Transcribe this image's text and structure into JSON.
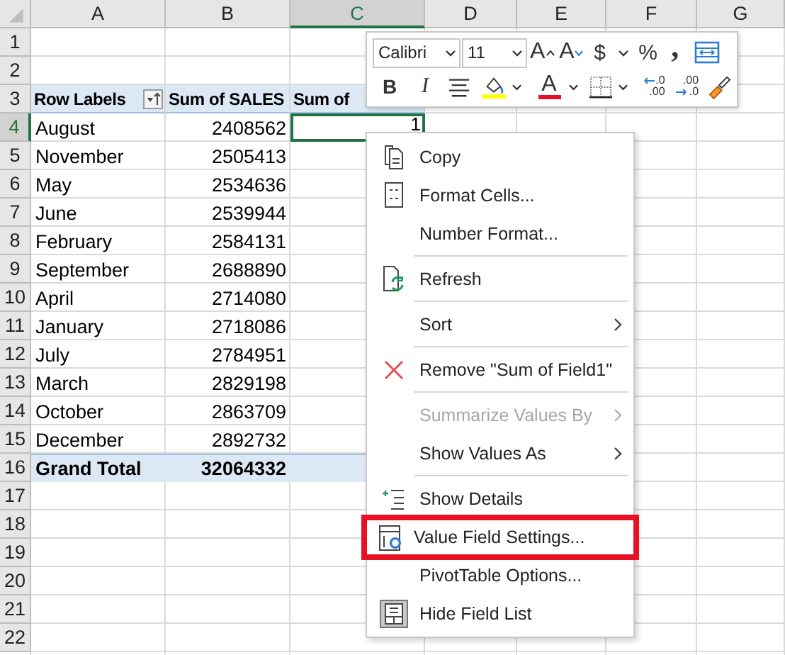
{
  "sheet": {
    "columns": [
      {
        "label": "A",
        "selected": false
      },
      {
        "label": "B",
        "selected": false
      },
      {
        "label": "C",
        "selected": true
      },
      {
        "label": "D",
        "selected": false
      },
      {
        "label": "E",
        "selected": false
      },
      {
        "label": "F",
        "selected": false
      },
      {
        "label": "G",
        "selected": false
      }
    ],
    "rows": [
      {
        "label": "1",
        "kind": "blank",
        "selected": false
      },
      {
        "label": "2",
        "kind": "blank",
        "selected": false
      },
      {
        "label": "3",
        "kind": "header",
        "selected": false,
        "filter_button": true,
        "cells": [
          "Row Labels",
          "Sum of SALES",
          "Sum of"
        ]
      },
      {
        "label": "4",
        "kind": "item",
        "selected": true,
        "cells": [
          "August",
          "2408562",
          "1"
        ]
      },
      {
        "label": "5",
        "kind": "item",
        "selected": false,
        "cells": [
          "November",
          "2505413"
        ]
      },
      {
        "label": "6",
        "kind": "item",
        "selected": false,
        "cells": [
          "May",
          "2534636"
        ]
      },
      {
        "label": "7",
        "kind": "item",
        "selected": false,
        "cells": [
          "June",
          "2539944"
        ]
      },
      {
        "label": "8",
        "kind": "item",
        "selected": false,
        "cells": [
          "February",
          "2584131"
        ]
      },
      {
        "label": "9",
        "kind": "item",
        "selected": false,
        "cells": [
          "September",
          "2688890"
        ]
      },
      {
        "label": "10",
        "kind": "item",
        "selected": false,
        "cells": [
          "April",
          "2714080"
        ]
      },
      {
        "label": "11",
        "kind": "item",
        "selected": false,
        "cells": [
          "January",
          "2718086"
        ]
      },
      {
        "label": "12",
        "kind": "item",
        "selected": false,
        "cells": [
          "July",
          "2784951"
        ]
      },
      {
        "label": "13",
        "kind": "item",
        "selected": false,
        "cells": [
          "March",
          "2829198"
        ]
      },
      {
        "label": "14",
        "kind": "item",
        "selected": false,
        "cells": [
          "October",
          "2863709"
        ]
      },
      {
        "label": "15",
        "kind": "item",
        "selected": false,
        "cells": [
          "December",
          "2892732"
        ]
      },
      {
        "label": "16",
        "kind": "total",
        "selected": false,
        "cells": [
          "Grand Total",
          "32064332"
        ]
      },
      {
        "label": "17",
        "kind": "blank",
        "selected": false
      },
      {
        "label": "18",
        "kind": "blank",
        "selected": false
      },
      {
        "label": "19",
        "kind": "blank",
        "selected": false
      },
      {
        "label": "20",
        "kind": "blank",
        "selected": false
      },
      {
        "label": "21",
        "kind": "blank",
        "selected": false
      },
      {
        "label": "22",
        "kind": "blank",
        "selected": false
      }
    ]
  },
  "mini_toolbar": {
    "font": "Calibri",
    "size": "11",
    "row1": [
      {
        "kind": "grow",
        "label": "A"
      },
      {
        "kind": "shrink",
        "label": "A"
      },
      {
        "kind": "text",
        "label": "$"
      },
      {
        "kind": "caret"
      },
      {
        "kind": "text",
        "label": "%"
      },
      {
        "kind": "comma",
        "label": ","
      },
      {
        "kind": "wrap"
      }
    ],
    "row2": [
      {
        "kind": "bold",
        "label": "B"
      },
      {
        "kind": "italic",
        "label": "I"
      },
      {
        "kind": "align"
      },
      {
        "kind": "fill"
      },
      {
        "kind": "caret"
      },
      {
        "kind": "fontcolor",
        "label": "A"
      },
      {
        "kind": "caret"
      },
      {
        "kind": "borders"
      },
      {
        "kind": "caret"
      },
      {
        "kind": "inc-decimal",
        "top": ".0",
        "bottom": ".00"
      },
      {
        "kind": "dec-decimal",
        "top": ".00",
        "bottom": ".0"
      },
      {
        "kind": "brush"
      }
    ]
  },
  "context_menu": {
    "groups": [
      [
        {
          "label": "Copy",
          "kind": "copy",
          "disabled": false,
          "submenu": false,
          "highlighted": false
        },
        {
          "label": "Format Cells...",
          "kind": "format",
          "disabled": false,
          "submenu": false,
          "highlighted": false
        },
        {
          "label": "Number Format...",
          "kind": "plain",
          "disabled": false,
          "submenu": false,
          "highlighted": false
        }
      ],
      [
        {
          "label": "Refresh",
          "kind": "refresh",
          "disabled": false,
          "submenu": false,
          "highlighted": false
        }
      ],
      [
        {
          "label": "Sort",
          "kind": "plain",
          "disabled": false,
          "submenu": true,
          "highlighted": false
        }
      ],
      [
        {
          "label": "Remove \"Sum of Field1\"",
          "kind": "remove",
          "disabled": false,
          "submenu": false,
          "highlighted": false
        }
      ],
      [
        {
          "label": "Summarize Values By",
          "kind": "plain",
          "disabled": true,
          "submenu": true,
          "highlighted": false
        },
        {
          "label": "Show Values As",
          "kind": "plain",
          "disabled": false,
          "submenu": true,
          "highlighted": false
        }
      ],
      [
        {
          "label": "Show Details",
          "kind": "details",
          "disabled": false,
          "submenu": false,
          "highlighted": false
        },
        {
          "label": "Value Field Settings...",
          "kind": "settings",
          "disabled": false,
          "submenu": false,
          "highlighted": true
        },
        {
          "label": "PivotTable Options...",
          "kind": "plain",
          "disabled": false,
          "submenu": false,
          "highlighted": false
        },
        {
          "label": "Hide Field List",
          "kind": "fieldlist",
          "disabled": false,
          "submenu": false,
          "highlighted": false
        }
      ]
    ]
  }
}
